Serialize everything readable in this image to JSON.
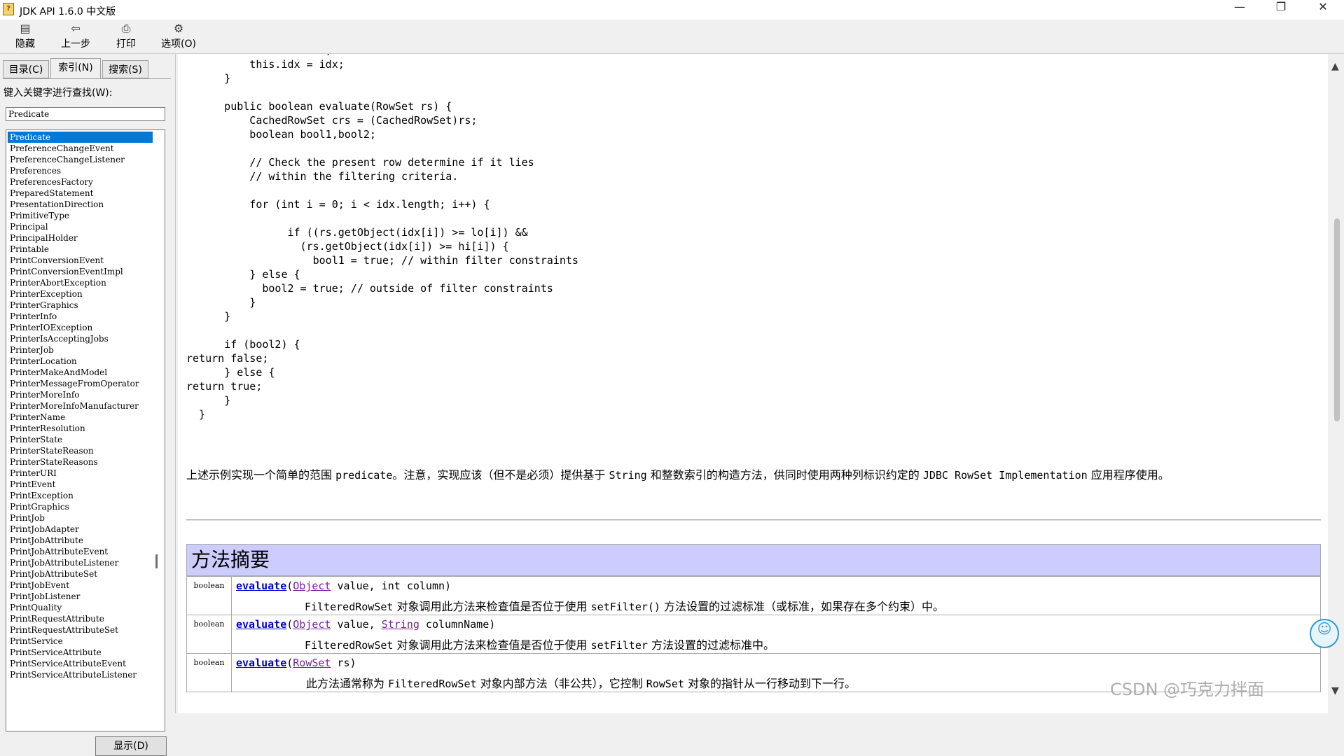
{
  "window": {
    "title": "JDK API 1.6.0 中文版",
    "controls": {
      "minimize": "—",
      "restore": "❐",
      "close": "✕"
    }
  },
  "toolbar": {
    "hide": {
      "label": "隐藏",
      "icon": "hide-pane-icon"
    },
    "back": {
      "label": "上一步",
      "icon": "back-arrow-icon"
    },
    "print": {
      "label": "打印",
      "icon": "printer-icon"
    },
    "options": {
      "label": "选项(O)",
      "icon": "options-icon"
    }
  },
  "nav": {
    "tabs": [
      {
        "label": "目录(C)"
      },
      {
        "label": "索引(N)"
      },
      {
        "label": "搜索(S)"
      }
    ],
    "active_tab": "索引(N)",
    "keyword_label": "键入关键字进行查找(W):",
    "search_value": "Predicate",
    "index_items": [
      "Predicate",
      "PreferenceChangeEvent",
      "PreferenceChangeListener",
      "Preferences",
      "PreferencesFactory",
      "PreparedStatement",
      "PresentationDirection",
      "PrimitiveType",
      "Principal",
      "PrincipalHolder",
      "Printable",
      "PrintConversionEvent",
      "PrintConversionEventImpl",
      "PrinterAbortException",
      "PrinterException",
      "PrinterGraphics",
      "PrinterInfo",
      "PrinterIOException",
      "PrinterIsAcceptingJobs",
      "PrinterJob",
      "PrinterLocation",
      "PrinterMakeAndModel",
      "PrinterMessageFromOperator",
      "PrinterMoreInfo",
      "PrinterMoreInfoManufacturer",
      "PrinterName",
      "PrinterResolution",
      "PrinterState",
      "PrinterStateReason",
      "PrinterStateReasons",
      "PrinterURI",
      "PrintEvent",
      "PrintException",
      "PrintGraphics",
      "PrintJob",
      "PrintJobAdapter",
      "PrintJobAttribute",
      "PrintJobAttributeEvent",
      "PrintJobAttributeListener",
      "PrintJobAttributeSet",
      "PrintJobEvent",
      "PrintJobListener",
      "PrintQuality",
      "PrintRequestAttribute",
      "PrintRequestAttributeSet",
      "PrintService",
      "PrintServiceAttribute",
      "PrintServiceAttributeEvent",
      "PrintServiceAttributeListener"
    ],
    "selected_index": 0,
    "display_button": "显示(D)"
  },
  "content": {
    "code": "          this.hi = hi;\n          this.idx = idx;\n      }\n\n      public boolean evaluate(RowSet rs) {\n          CachedRowSet crs = (CachedRowSet)rs;\n          boolean bool1,bool2;\n\n          // Check the present row determine if it lies\n          // within the filtering criteria.\n\n          for (int i = 0; i < idx.length; i++) {\n\n                if ((rs.getObject(idx[i]) >= lo[i]) &&\n                  (rs.getObject(idx[i]) >= hi[i]) {\n                    bool1 = true; // within filter constraints\n          } else {\n            bool2 = true; // outside of filter constraints\n          }\n      }\n\n      if (bool2) {\nreturn false;\n      } else {\nreturn true;\n      }\n  }",
    "paragraph": {
      "p1": "上述示例实现一个简单的范围 ",
      "c1": "predicate",
      "p2": "。注意，实现应该（但不是必须）提供基于 ",
      "c2": "String",
      "p3": " 和整数索引的构造方法，供同时使用两种列标识约定的 ",
      "c3": "JDBC RowSet Implementation",
      "p4": " 应用程序使用。"
    },
    "summary": {
      "title": "方法摘要",
      "rows": [
        {
          "type": "boolean",
          "method": "evaluate",
          "p_open": "(",
          "param_type": "Object",
          "param_rest": " value, int column)",
          "desc_code": "FilteredRowSet",
          "desc_text": " 对象调用此方法来检查值是否位于使用 ",
          "desc_code2": "setFilter()",
          "desc_text2": " 方法设置的过滤标准（或标准，如果存在多个约束）中。"
        },
        {
          "type": "boolean",
          "method": "evaluate",
          "p_open": "(",
          "param_type": "Object",
          "param_mid": " value, ",
          "param_type2": "String",
          "param_rest": " columnName)",
          "desc_code": "FilteredRowSet",
          "desc_text": " 对象调用此方法来检查值是否位于使用 ",
          "desc_code2": "setFilter",
          "desc_text2": " 方法设置的过滤标准中。"
        },
        {
          "type": "boolean",
          "method": "evaluate",
          "p_open": "(",
          "param_type": "RowSet",
          "param_rest": " rs)",
          "desc_text_pre": "此方法通常称为 ",
          "desc_code": "FilteredRowSet",
          "desc_text": " 对象内部方法（非公共），它控制 ",
          "desc_code2": "RowSet",
          "desc_text2": " 对象的指针从一行移动到下一行。"
        }
      ]
    }
  },
  "watermark": "CSDN @巧克力拌面"
}
